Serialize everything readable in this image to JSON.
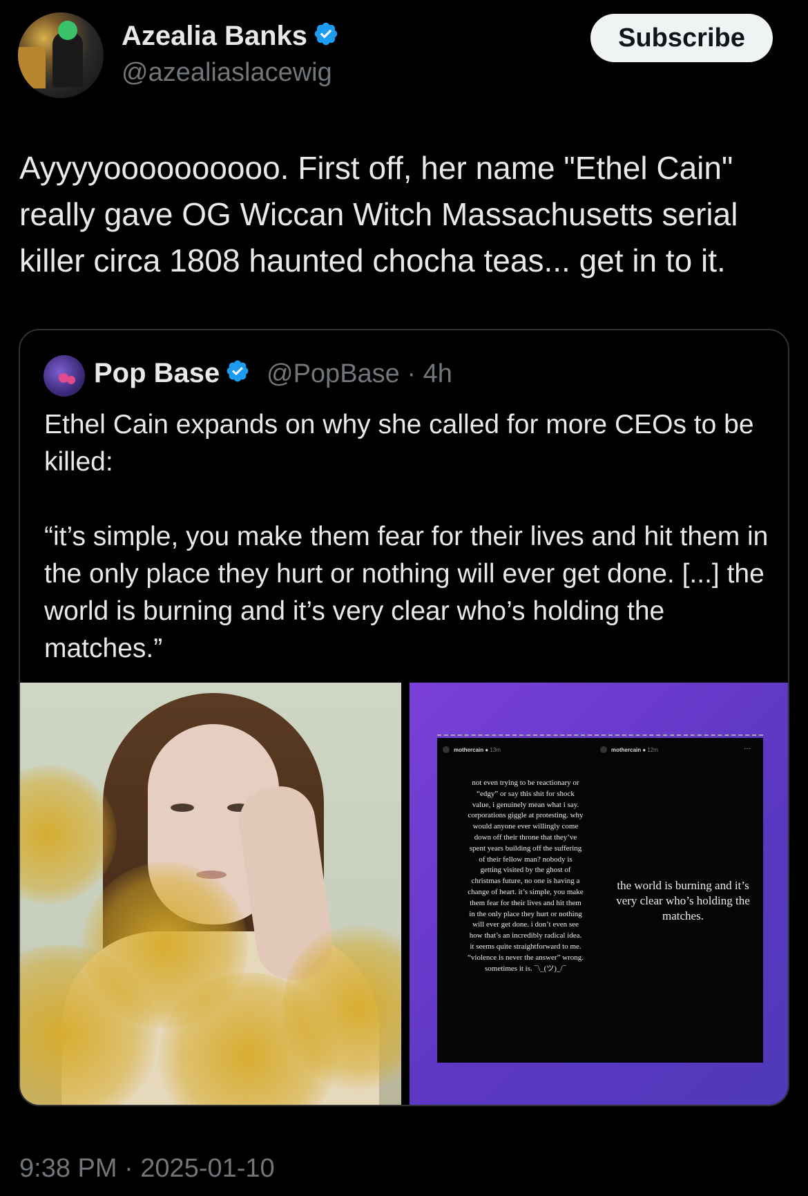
{
  "author": {
    "display_name": "Azealia Banks",
    "handle": "@azealiaslacewig",
    "avatar_icon": "profile-photo",
    "verified_icon": "verified-badge-icon"
  },
  "subscribe_label": "Subscribe",
  "tweet": {
    "text": "Ayyyyoooooooooo. First off, her name \"Ethel Cain\" really gave OG Wiccan Witch Massachusetts serial killer circa 1808 haunted chocha teas... get in to it.",
    "timestamp": "9:38 PM · 2025-01-10"
  },
  "quoted": {
    "display_name": "Pop Base",
    "handle": "@PopBase",
    "separator": "·",
    "age": "4h",
    "text": "Ethel Cain expands on why she called for more CEOs to be killed:\n\n“it’s simple, you make them fear for their lives and hit them in the only place they hurt or nothing will ever get done. [...] the world is burning and it’s very clear who’s holding the matches.”",
    "story": {
      "left_user": "mothercain",
      "left_time": "13m",
      "right_user": "mothercain",
      "right_time": "12m",
      "left_text": "not even trying to be reactionary or “edgy” or say this shit for shock value, i genuinely mean what i say. corporations giggle at protesting. why would anyone ever willingly come down off their throne that they’ve spent years building off the suffering of their fellow man? nobody is getting visited by the ghost of christmas future, no one is having a change of heart. it’s simple, you make them fear for their lives and hit them in the only place they hurt or nothing will ever get done. i don’t even see how that’s an incredibly radical idea. it seems quite straightforward to me. “violence is never the answer” wrong. sometimes it is. ¯\\_(ツ)_/¯",
      "right_text": "the world is burning and it’s very clear who’s holding the matches.",
      "more_label": "···"
    }
  },
  "colors": {
    "background": "#000000",
    "text": "#e7e9ea",
    "muted": "#71767b",
    "verified": "#1d9bf0",
    "story_purple": "#6b3bd0"
  }
}
